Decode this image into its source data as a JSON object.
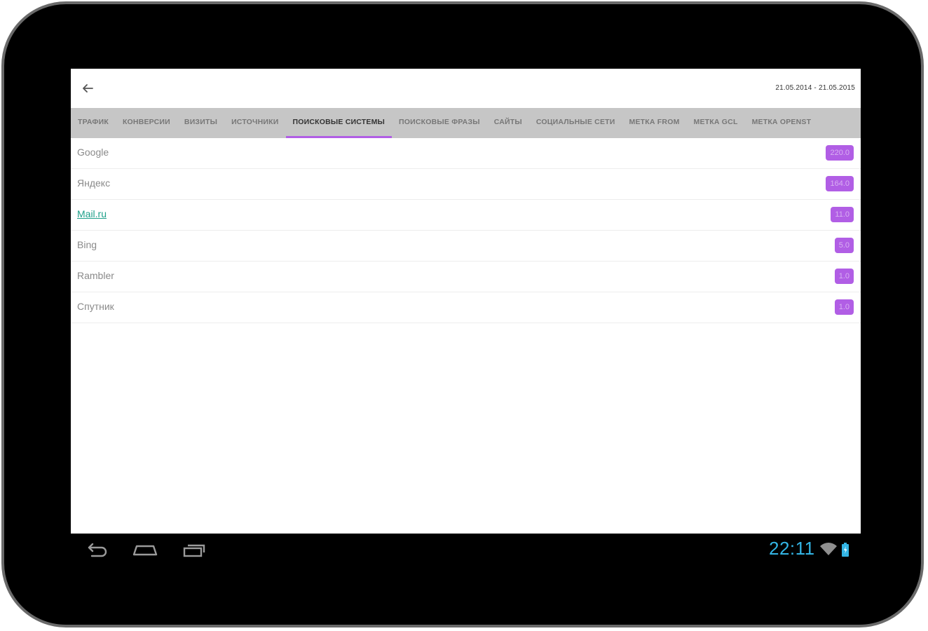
{
  "header": {
    "date_range": "21.05.2014 - 21.05.2015"
  },
  "tabs": [
    {
      "label": "Трафик"
    },
    {
      "label": "Конверсии"
    },
    {
      "label": "Визиты"
    },
    {
      "label": "Источники"
    },
    {
      "label": "Поисковые системы"
    },
    {
      "label": "Поисковые фразы"
    },
    {
      "label": "Сайты"
    },
    {
      "label": "Социальные сети"
    },
    {
      "label": "Метка from"
    },
    {
      "label": "Метка gcl"
    },
    {
      "label": "Метка openst"
    }
  ],
  "active_tab": "Поисковые системы",
  "rows": [
    {
      "label": "Google",
      "value": "220.0"
    },
    {
      "label": "Яндекс",
      "value": "164.0"
    },
    {
      "label": "Mail.ru",
      "value": "11.0"
    },
    {
      "label": "Bing",
      "value": "5.0"
    },
    {
      "label": "Rambler",
      "value": "1.0"
    },
    {
      "label": "Спутник",
      "value": "1.0"
    }
  ],
  "status_bar": {
    "time": "22:11"
  },
  "icons": {
    "back": "arrow-left-icon",
    "nav_back": "back-icon",
    "nav_home": "home-icon",
    "nav_recents": "recents-icon",
    "wifi": "wifi-icon",
    "battery": "battery-icon"
  },
  "colors": {
    "accent": "#b15ee5",
    "tab_bar": "#c6c6c6",
    "clock": "#33b5e5",
    "link": "#1fa08a"
  }
}
